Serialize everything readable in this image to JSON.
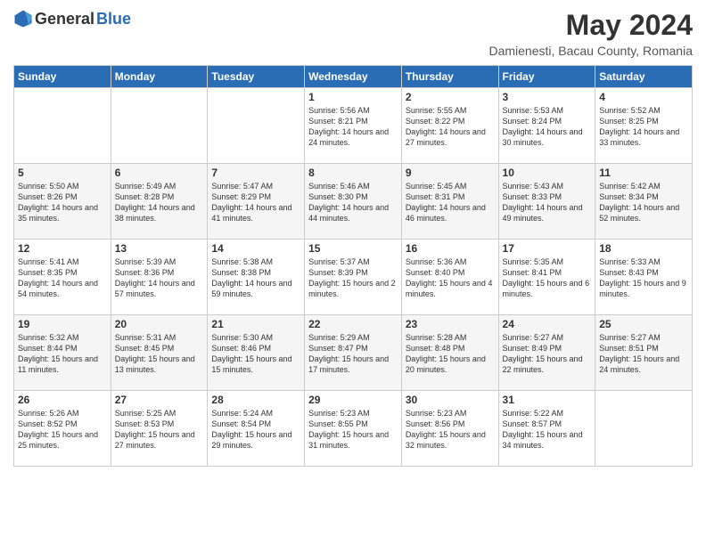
{
  "logo": {
    "general": "General",
    "blue": "Blue"
  },
  "title": "May 2024",
  "subtitle": "Damienesti, Bacau County, Romania",
  "days_header": [
    "Sunday",
    "Monday",
    "Tuesday",
    "Wednesday",
    "Thursday",
    "Friday",
    "Saturday"
  ],
  "weeks": [
    [
      {
        "day": "",
        "info": ""
      },
      {
        "day": "",
        "info": ""
      },
      {
        "day": "",
        "info": ""
      },
      {
        "day": "1",
        "info": "Sunrise: 5:56 AM\nSunset: 8:21 PM\nDaylight: 14 hours\nand 24 minutes."
      },
      {
        "day": "2",
        "info": "Sunrise: 5:55 AM\nSunset: 8:22 PM\nDaylight: 14 hours\nand 27 minutes."
      },
      {
        "day": "3",
        "info": "Sunrise: 5:53 AM\nSunset: 8:24 PM\nDaylight: 14 hours\nand 30 minutes."
      },
      {
        "day": "4",
        "info": "Sunrise: 5:52 AM\nSunset: 8:25 PM\nDaylight: 14 hours\nand 33 minutes."
      }
    ],
    [
      {
        "day": "5",
        "info": "Sunrise: 5:50 AM\nSunset: 8:26 PM\nDaylight: 14 hours\nand 35 minutes."
      },
      {
        "day": "6",
        "info": "Sunrise: 5:49 AM\nSunset: 8:28 PM\nDaylight: 14 hours\nand 38 minutes."
      },
      {
        "day": "7",
        "info": "Sunrise: 5:47 AM\nSunset: 8:29 PM\nDaylight: 14 hours\nand 41 minutes."
      },
      {
        "day": "8",
        "info": "Sunrise: 5:46 AM\nSunset: 8:30 PM\nDaylight: 14 hours\nand 44 minutes."
      },
      {
        "day": "9",
        "info": "Sunrise: 5:45 AM\nSunset: 8:31 PM\nDaylight: 14 hours\nand 46 minutes."
      },
      {
        "day": "10",
        "info": "Sunrise: 5:43 AM\nSunset: 8:33 PM\nDaylight: 14 hours\nand 49 minutes."
      },
      {
        "day": "11",
        "info": "Sunrise: 5:42 AM\nSunset: 8:34 PM\nDaylight: 14 hours\nand 52 minutes."
      }
    ],
    [
      {
        "day": "12",
        "info": "Sunrise: 5:41 AM\nSunset: 8:35 PM\nDaylight: 14 hours\nand 54 minutes."
      },
      {
        "day": "13",
        "info": "Sunrise: 5:39 AM\nSunset: 8:36 PM\nDaylight: 14 hours\nand 57 minutes."
      },
      {
        "day": "14",
        "info": "Sunrise: 5:38 AM\nSunset: 8:38 PM\nDaylight: 14 hours\nand 59 minutes."
      },
      {
        "day": "15",
        "info": "Sunrise: 5:37 AM\nSunset: 8:39 PM\nDaylight: 15 hours\nand 2 minutes."
      },
      {
        "day": "16",
        "info": "Sunrise: 5:36 AM\nSunset: 8:40 PM\nDaylight: 15 hours\nand 4 minutes."
      },
      {
        "day": "17",
        "info": "Sunrise: 5:35 AM\nSunset: 8:41 PM\nDaylight: 15 hours\nand 6 minutes."
      },
      {
        "day": "18",
        "info": "Sunrise: 5:33 AM\nSunset: 8:43 PM\nDaylight: 15 hours\nand 9 minutes."
      }
    ],
    [
      {
        "day": "19",
        "info": "Sunrise: 5:32 AM\nSunset: 8:44 PM\nDaylight: 15 hours\nand 11 minutes."
      },
      {
        "day": "20",
        "info": "Sunrise: 5:31 AM\nSunset: 8:45 PM\nDaylight: 15 hours\nand 13 minutes."
      },
      {
        "day": "21",
        "info": "Sunrise: 5:30 AM\nSunset: 8:46 PM\nDaylight: 15 hours\nand 15 minutes."
      },
      {
        "day": "22",
        "info": "Sunrise: 5:29 AM\nSunset: 8:47 PM\nDaylight: 15 hours\nand 17 minutes."
      },
      {
        "day": "23",
        "info": "Sunrise: 5:28 AM\nSunset: 8:48 PM\nDaylight: 15 hours\nand 20 minutes."
      },
      {
        "day": "24",
        "info": "Sunrise: 5:27 AM\nSunset: 8:49 PM\nDaylight: 15 hours\nand 22 minutes."
      },
      {
        "day": "25",
        "info": "Sunrise: 5:27 AM\nSunset: 8:51 PM\nDaylight: 15 hours\nand 24 minutes."
      }
    ],
    [
      {
        "day": "26",
        "info": "Sunrise: 5:26 AM\nSunset: 8:52 PM\nDaylight: 15 hours\nand 25 minutes."
      },
      {
        "day": "27",
        "info": "Sunrise: 5:25 AM\nSunset: 8:53 PM\nDaylight: 15 hours\nand 27 minutes."
      },
      {
        "day": "28",
        "info": "Sunrise: 5:24 AM\nSunset: 8:54 PM\nDaylight: 15 hours\nand 29 minutes."
      },
      {
        "day": "29",
        "info": "Sunrise: 5:23 AM\nSunset: 8:55 PM\nDaylight: 15 hours\nand 31 minutes."
      },
      {
        "day": "30",
        "info": "Sunrise: 5:23 AM\nSunset: 8:56 PM\nDaylight: 15 hours\nand 32 minutes."
      },
      {
        "day": "31",
        "info": "Sunrise: 5:22 AM\nSunset: 8:57 PM\nDaylight: 15 hours\nand 34 minutes."
      },
      {
        "day": "",
        "info": ""
      }
    ]
  ]
}
